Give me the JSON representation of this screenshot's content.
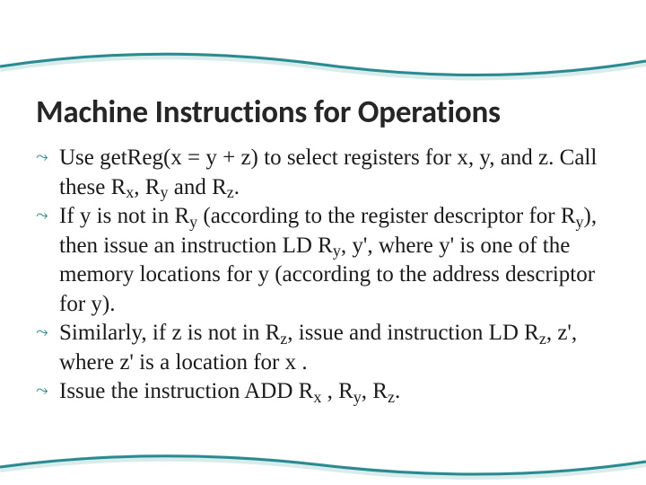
{
  "title": "Machine Instructions for Operations",
  "bullets": [
    {
      "html": "Use getReg(x = y + z) to select registers for x, y, and z. Call these R<sub>x</sub>, R<sub>y</sub> and R<sub>z</sub>."
    },
    {
      "html": "If y is not in R<sub>y</sub> (according to the register descriptor for R<sub>y</sub>), then issue an instruction LD R<sub>y</sub>, y', where y' is one of the memory locations for y (according to the address descriptor for y)."
    },
    {
      "html": "Similarly, if z is not in R<sub>z</sub>, issue and instruction LD R<sub>z</sub>, z', where z' is a location for x ."
    },
    {
      "html": "Issue the instruction ADD R<sub>x</sub> , R<sub>y</sub>, R<sub>z</sub>."
    }
  ],
  "bullet_glyph": "⤳",
  "accent_color": "#2a8a8f",
  "wave_color": "#2a8a8f",
  "wave_shadow": "#d7eceb"
}
